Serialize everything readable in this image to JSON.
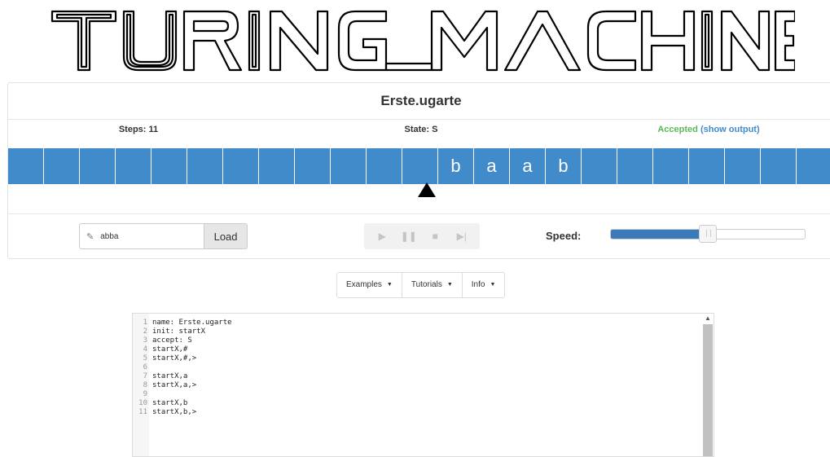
{
  "logo": {
    "text": "TURING MACHINE"
  },
  "machine": {
    "title": "Erste.ugarte",
    "steps_label": "Steps: 11",
    "state_label": "State: S",
    "status": "Accepted",
    "show_output": "(show output)"
  },
  "tape": {
    "cells": [
      "",
      "",
      "",
      "",
      "",
      "",
      "",
      "",
      "",
      "",
      "",
      "",
      "b",
      "a",
      "a",
      "b",
      "",
      "",
      "",
      "",
      "",
      "",
      ""
    ],
    "head_index": 11
  },
  "controls": {
    "input_value": "abba",
    "load_label": "Load",
    "speed_label": "Speed:",
    "speed_fraction": 0.5
  },
  "menu": {
    "examples": "Examples",
    "tutorials": "Tutorials",
    "info": "Info"
  },
  "editor": {
    "lines": [
      {
        "no": "1",
        "text": "name: Erste.ugarte"
      },
      {
        "no": "2",
        "text": "init: startX"
      },
      {
        "no": "3",
        "text": "accept: S"
      },
      {
        "no": "4",
        "text": "startX,#"
      },
      {
        "no": "5",
        "text": "startX,#,>"
      },
      {
        "no": "6",
        "text": ""
      },
      {
        "no": "7",
        "text": "startX,a"
      },
      {
        "no": "8",
        "text": "startX,a,>"
      },
      {
        "no": "9",
        "text": ""
      },
      {
        "no": "10",
        "text": "startX,b"
      },
      {
        "no": "11",
        "text": "startX,b,>"
      }
    ]
  },
  "colors": {
    "tape": "#428bca",
    "accepted": "#5cb85c",
    "link": "#428bca"
  }
}
